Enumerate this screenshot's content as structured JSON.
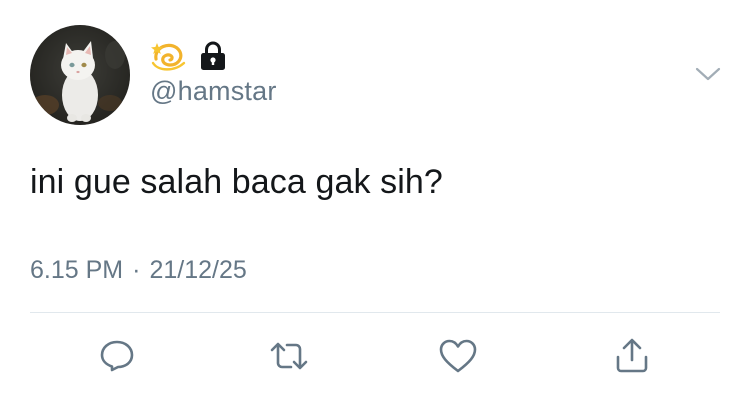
{
  "tweet": {
    "handle": "@hamstar",
    "name_icons": [
      "dizzy-emoji",
      "lock-icon"
    ],
    "text": "ini gue salah baca gak sih?",
    "time": "6.15 PM",
    "separator": "·",
    "date": "21/12/25",
    "menu_icon": "chevron-down-icon"
  },
  "actions": [
    {
      "icon": "reply-icon"
    },
    {
      "icon": "retweet-icon"
    },
    {
      "icon": "like-icon"
    },
    {
      "icon": "share-icon"
    }
  ],
  "colors": {
    "text": "#14171a",
    "secondary": "#657786",
    "divider": "#e1e8ed",
    "dizzy_yellow": "#f7c531",
    "lock": "#14171a"
  }
}
